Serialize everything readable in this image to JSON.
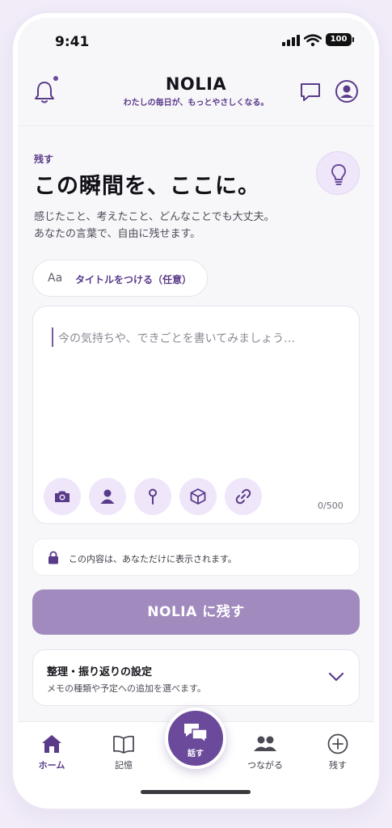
{
  "status_bar": {
    "time": "9:41",
    "battery": "100"
  },
  "header": {
    "app_name": "NOLIA",
    "tagline": "わたしの毎日が、もっとやさしくなる。",
    "icons": [
      "bell-icon",
      "chat-bubble-icon",
      "profile-icon"
    ]
  },
  "main": {
    "eyebrow": "残す",
    "title": "この瞬間を、ここに。",
    "description_line1": "感じたこと、考えたこと、どんなことでも大丈夫。",
    "description_line2": "あなたの言葉で、自由に残せます。",
    "hint_icon": "lightbulb-icon",
    "title_chip": {
      "prefix": "Aa",
      "label": "タイトルをつける（任意）"
    },
    "editor": {
      "placeholder": "今の気持ちや、できごとを書いてみましょう…",
      "counter": "0/500",
      "tools": [
        "camera-icon",
        "person-icon",
        "location-pin-icon",
        "box-icon",
        "link-icon"
      ]
    },
    "privacy_note": "この内容は、あなただけに表示されます。",
    "submit_label": "NOLIA に残す",
    "settings": {
      "title": "整理・振り返りの設定",
      "subtitle": "メモの種類や予定への追加を選べます。"
    }
  },
  "tabbar": {
    "items": [
      {
        "label": "ホーム",
        "icon": "home-icon",
        "active": true
      },
      {
        "label": "記憶",
        "icon": "book-icon",
        "active": false
      },
      {
        "label": "話す",
        "icon": "chat-bubbles-icon",
        "active": false
      },
      {
        "label": "つながる",
        "icon": "people-icon",
        "active": false
      },
      {
        "label": "残す",
        "icon": "plus-circle-icon",
        "active": false
      }
    ]
  },
  "colors": {
    "accent": "#6b4a9b",
    "accent_light": "#efe6fa",
    "submit_disabled": "#a18abe",
    "background": "#f7f6f9"
  }
}
